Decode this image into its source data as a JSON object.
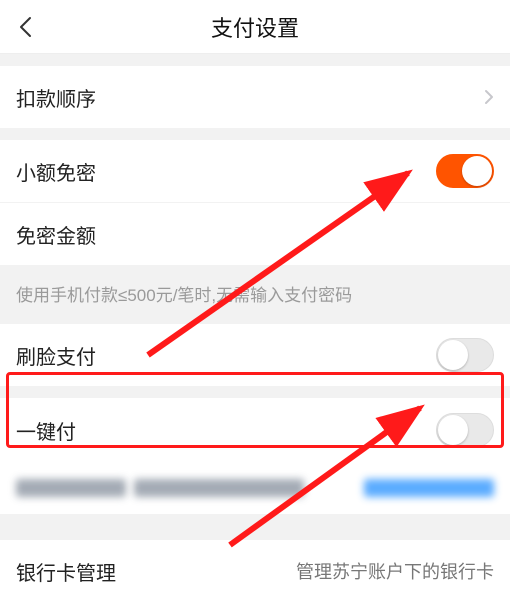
{
  "header": {
    "title": "支付设置"
  },
  "rows": {
    "deductOrder": {
      "label": "扣款顺序",
      "value": "　　　　　　　　　"
    },
    "smallNoPwd": {
      "label": "小额免密"
    },
    "noPwdAmount": {
      "label": "免密金额",
      "value": "　　　"
    },
    "facePay": {
      "label": "刷脸支付"
    },
    "oneKeyPay": {
      "label": "一键付"
    },
    "bankManage": {
      "label": "银行卡管理",
      "value": "管理苏宁账户下的银行卡"
    }
  },
  "hint": "使用手机付款≤500元/笔时,无需输入支付密码",
  "toggles": {
    "smallNoPwd": true,
    "facePay": false,
    "oneKeyPay": false
  },
  "colors": {
    "accent": "#ff5400",
    "highlight": "#ff1a1a"
  }
}
